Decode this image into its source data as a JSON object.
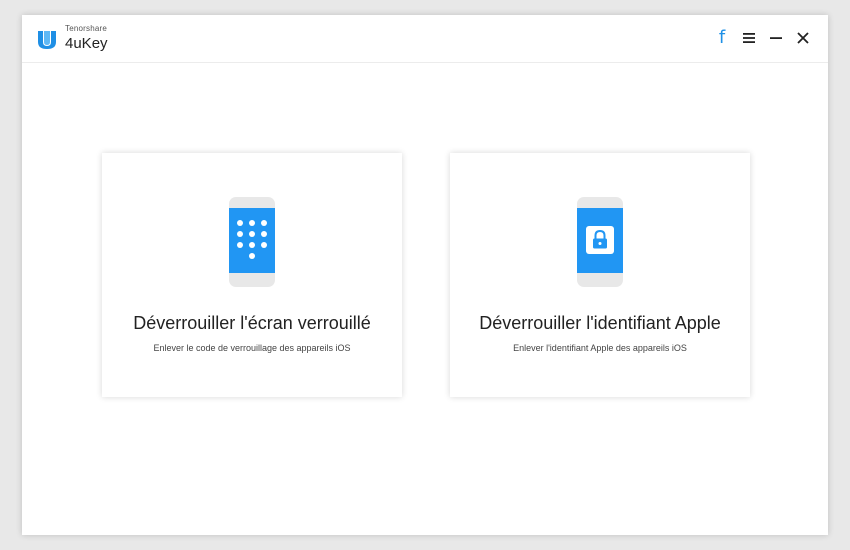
{
  "app": {
    "company": "Tenorshare",
    "product": "4uKey"
  },
  "toolbar": {
    "facebook_glyph": "f",
    "icons": [
      "facebook-icon",
      "menu-icon",
      "minimize-icon",
      "close-icon"
    ]
  },
  "colors": {
    "accent": "#2196f3",
    "facebook": "#1e90e6",
    "phone_body": "#e8e8e8",
    "screen": "#2196f3"
  },
  "cards": [
    {
      "title": "Déverrouiller l'écran verrouillé",
      "subtitle": "Enlever le code de verrouillage des appareils iOS",
      "icon": "phone-keypad-icon"
    },
    {
      "title": "Déverrouiller l'identifiant Apple",
      "subtitle": "Enlever l'identifiant Apple des appareils iOS",
      "icon": "phone-lock-icon"
    }
  ]
}
